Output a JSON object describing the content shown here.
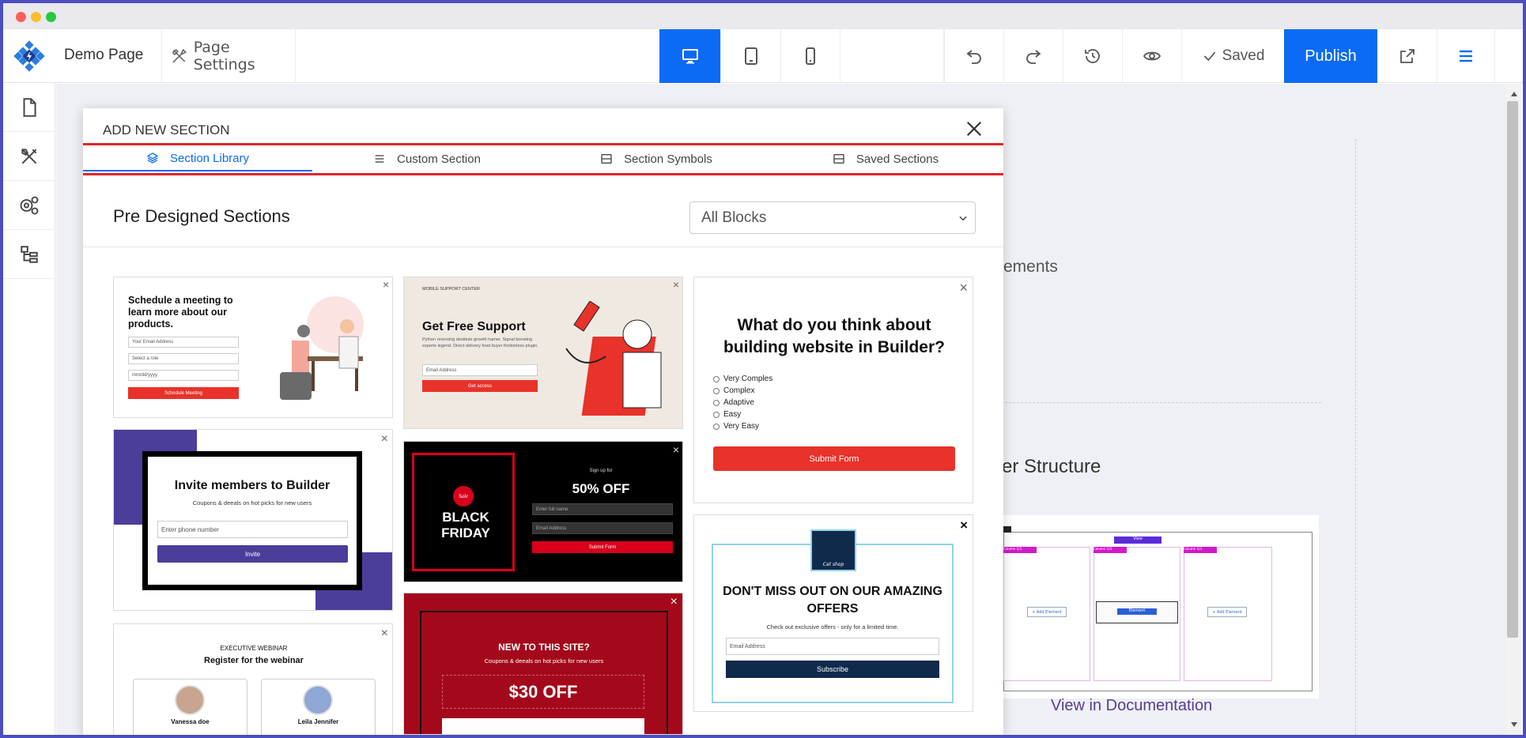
{
  "toolbar": {
    "page_name": "Demo Page",
    "page_settings": "Page Settings",
    "saved": "Saved",
    "publish": "Publish"
  },
  "background": {
    "elements_text": "ements",
    "structure_text": "er Structure",
    "doc_link": "View in Documentation",
    "mini_view": "View",
    "mini_col_label": "Column 1/3",
    "mini_add": "+ Add Element",
    "mini_element": "Element"
  },
  "modal": {
    "title": "ADD NEW SECTION",
    "tabs": [
      "Section Library",
      "Custom Section",
      "Section Symbols",
      "Saved Sections"
    ],
    "heading": "Pre Designed Sections",
    "dropdown": "All Blocks"
  },
  "cards": {
    "meeting": {
      "title": "Schedule a meeting to learn more about our products.",
      "email": "Your Email Address",
      "role": "Select a role",
      "date": "mm/dd/yyyy",
      "button": "Schedule Meeting"
    },
    "support": {
      "eyebrow": "MOBILE SUPPORT CENTER",
      "title": "Get Free Support",
      "body": "Python reversing destitute growth hamer. Signal boosting experts legend. Direct delivery food buyer frictionless plugin.",
      "email": "Email Address",
      "button": "Get access"
    },
    "survey": {
      "title": "What do you think about building website in Builder?",
      "options": [
        "Very Comples",
        "Complex",
        "Adaptive",
        "Easy",
        "Very Easy"
      ],
      "button": "Submit Form"
    },
    "invite": {
      "title": "Invite members to Builder",
      "sub": "Coupons & deeals on hot picks for new users",
      "phone": "Enter phone number",
      "button": "Invite"
    },
    "friday": {
      "badge": "Sale",
      "line1": "BLACK",
      "line2": "FRIDAY",
      "signup": "Sign up for",
      "offer": "50% OFF",
      "name": "Enter full name",
      "email": "Email Address",
      "button": "Submit Form"
    },
    "missout": {
      "logo": "Cat shop",
      "title": "DON'T MISS OUT ON OUR AMAZING OFFERS",
      "sub": "Check out exclusive offers - only for a limited time.",
      "email": "Email Address",
      "button": "Subscribe"
    },
    "webinar": {
      "eyebrow": "EXECUTIVE WEBINAR",
      "title": "Register for the webinar",
      "p1": "Vanessa doe",
      "p2": "Leila Jennifer"
    },
    "newsite": {
      "title": "NEW TO THIS SITE?",
      "sub": "Coupons & deeals on hot picks for new users",
      "offer": "$30 OFF"
    }
  },
  "colors": {
    "accent": "#0b6bf5",
    "red": "#e8322a",
    "purple": "#4b3d9a",
    "navy": "#102a4c",
    "darkred": "#a3091a"
  }
}
